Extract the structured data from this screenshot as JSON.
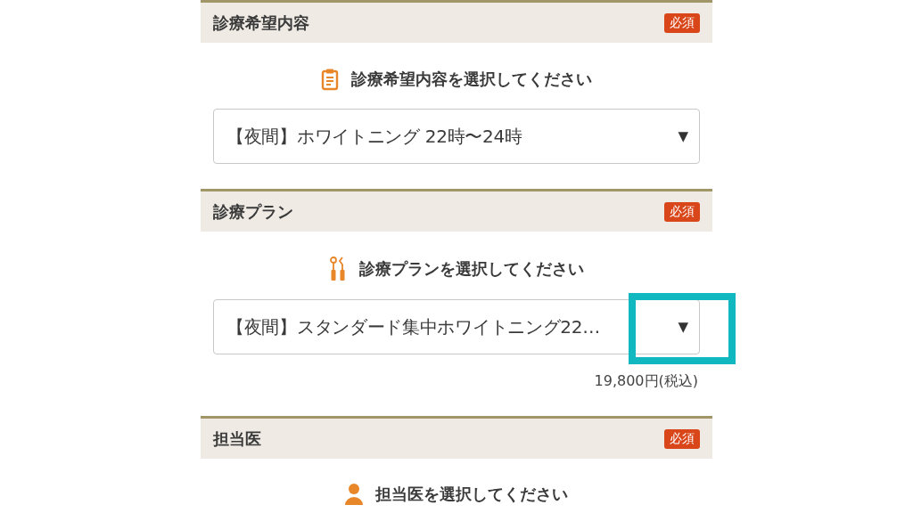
{
  "sections": [
    {
      "title": "診療希望内容",
      "badge": "必須",
      "prompt": {
        "kind": "clipboard",
        "text": "診療希望内容を選択してください"
      },
      "select": {
        "value": "【夜間】ホワイトニング 22時〜24時",
        "arrow": "▼",
        "highlighted": false
      }
    },
    {
      "title": "診療プラン",
      "badge": "必須",
      "prompt": {
        "kind": "tools",
        "text": "診療プランを選択してください"
      },
      "select": {
        "value": "【夜間】スタンダード集中ホワイトニング22…",
        "arrow": "▼",
        "highlighted": true
      },
      "price": "19,800円(税込)"
    },
    {
      "title": "担当医",
      "badge": "必須",
      "prompt": {
        "kind": "person",
        "text": "担当医を選択してください"
      }
    }
  ]
}
